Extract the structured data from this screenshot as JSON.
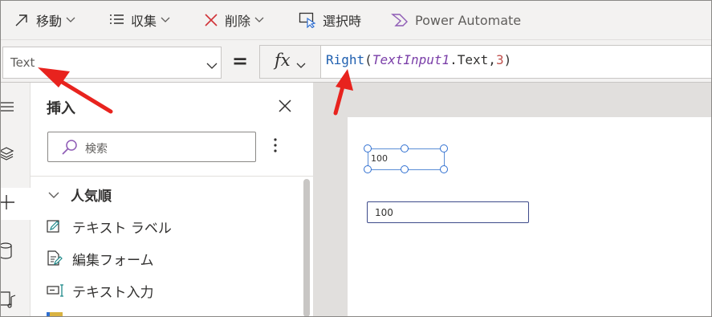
{
  "command_bar": {
    "move": "移動",
    "collect": "収集",
    "delete": "削除",
    "on_select": "選択時",
    "power_automate": "Power Automate"
  },
  "formula_bar": {
    "property": "Text",
    "equals": "=",
    "fx": "fx",
    "formula": {
      "fn": "Right",
      "open": "(",
      "var": "TextInput1",
      "dot_text": ".Text,",
      "num": "3",
      "close": ")"
    }
  },
  "insert_pane": {
    "title": "挿入",
    "search_placeholder": "検索",
    "group": "人気順",
    "items": [
      {
        "label": "テキスト ラベル",
        "icon": "edit-label-icon"
      },
      {
        "label": "編集フォーム",
        "icon": "edit-form-icon"
      },
      {
        "label": "テキスト入力",
        "icon": "text-input-icon"
      }
    ]
  },
  "canvas": {
    "label_value": "100",
    "input_value": "100"
  },
  "left_rail": [
    "tree-view-icon",
    "layers-icon",
    "insert-icon",
    "data-icon",
    "media-icon"
  ],
  "colors": {
    "accent": "#2f6fd1",
    "arrow": "#e8231e",
    "delete": "#d13438"
  }
}
